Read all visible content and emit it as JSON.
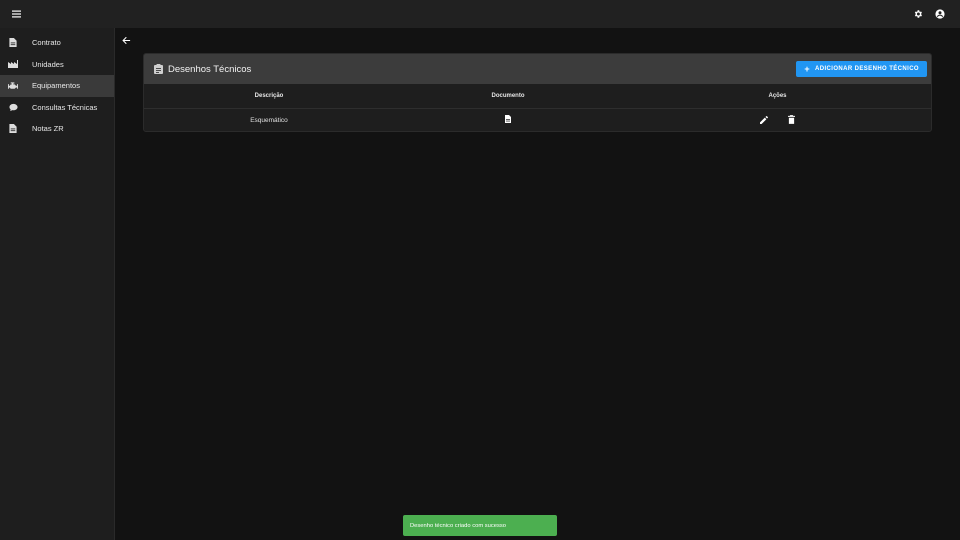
{
  "appbar": {
    "menu_icon": "menu-icon",
    "settings_icon": "gear-icon",
    "account_icon": "account-circle-icon"
  },
  "sidebar": {
    "items": [
      {
        "label": "Contrato",
        "icon": "document-icon",
        "active": false
      },
      {
        "label": "Unidades",
        "icon": "factory-icon",
        "active": false
      },
      {
        "label": "Equipamentos",
        "icon": "engine-icon",
        "active": true
      },
      {
        "label": "Consultas Técnicas",
        "icon": "chat-icon",
        "active": false
      },
      {
        "label": "Notas ZR",
        "icon": "document-icon",
        "active": false
      }
    ]
  },
  "page": {
    "back_icon": "arrow-left-icon"
  },
  "card": {
    "title": "Desenhos Técnicos",
    "title_icon": "clipboard-document-icon",
    "add_button_label": "ADICIONAR DESENHO TÉCNICO",
    "table": {
      "headers": [
        "Descrição",
        "Documento",
        "Ações"
      ],
      "rows": [
        {
          "descricao": "Esquemático",
          "documento_icon": "file-icon",
          "acoes": [
            "edit-icon",
            "delete-icon"
          ]
        }
      ]
    }
  },
  "toast": {
    "message": "Desenho técnico criado com sucesso"
  },
  "colors": {
    "background": "#121212",
    "appbar": "#212121",
    "sidebar": "#1e1e1e",
    "sidebar_active": "#3a3a3a",
    "card_header": "#3c3c3c",
    "accent": "#2196f3",
    "toast": "#4caf50"
  }
}
